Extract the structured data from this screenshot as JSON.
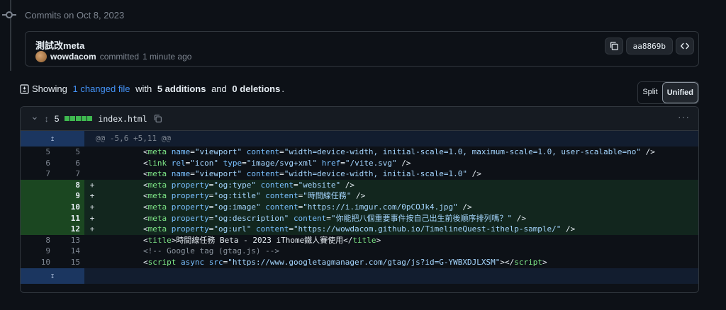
{
  "timeline": {
    "heading": "Commits on Oct 8, 2023"
  },
  "commit": {
    "title": "測試改meta",
    "author": "wowdacom",
    "action": "committed",
    "time": "1 minute ago",
    "sha": "aa8869b"
  },
  "summary": {
    "prefix": "Showing",
    "changed": "1 changed file",
    "with": "with",
    "additions": "5 additions",
    "and": "and",
    "deletions": "0 deletions",
    "end": "."
  },
  "view_toggle": {
    "split": "Split",
    "unified": "Unified"
  },
  "file": {
    "changes": "5",
    "name": "index.html",
    "hunk": "@@ -5,6 +5,11 @@",
    "lines": [
      {
        "type": "ctx",
        "old": "5",
        "new": "5",
        "parts": [
          [
            "t",
            "        <"
          ],
          [
            "tag",
            "meta"
          ],
          [
            "t",
            " "
          ],
          [
            "attr",
            "name"
          ],
          [
            "t",
            "="
          ],
          [
            "str",
            "\"viewport\""
          ],
          [
            "t",
            " "
          ],
          [
            "attr",
            "content"
          ],
          [
            "t",
            "="
          ],
          [
            "str",
            "\"width=device-width, initial-scale=1.0, maximum-scale=1.0, user-scalable=no\""
          ],
          [
            "t",
            " />"
          ]
        ]
      },
      {
        "type": "ctx",
        "old": "6",
        "new": "6",
        "parts": [
          [
            "t",
            "        <"
          ],
          [
            "tag",
            "link"
          ],
          [
            "t",
            " "
          ],
          [
            "attr",
            "rel"
          ],
          [
            "t",
            "="
          ],
          [
            "str",
            "\"icon\""
          ],
          [
            "t",
            " "
          ],
          [
            "attr",
            "type"
          ],
          [
            "t",
            "="
          ],
          [
            "str",
            "\"image/svg+xml\""
          ],
          [
            "t",
            " "
          ],
          [
            "attr",
            "href"
          ],
          [
            "t",
            "="
          ],
          [
            "str",
            "\"/vite.svg\""
          ],
          [
            "t",
            " />"
          ]
        ]
      },
      {
        "type": "ctx",
        "old": "7",
        "new": "7",
        "parts": [
          [
            "t",
            "        <"
          ],
          [
            "tag",
            "meta"
          ],
          [
            "t",
            " "
          ],
          [
            "attr",
            "name"
          ],
          [
            "t",
            "="
          ],
          [
            "str",
            "\"viewport\""
          ],
          [
            "t",
            " "
          ],
          [
            "attr",
            "content"
          ],
          [
            "t",
            "="
          ],
          [
            "str",
            "\"width=device-width, initial-scale=1.0\""
          ],
          [
            "t",
            " />"
          ]
        ]
      },
      {
        "type": "add",
        "old": "",
        "new": "8",
        "parts": [
          [
            "t",
            "        <"
          ],
          [
            "tag",
            "meta"
          ],
          [
            "t",
            " "
          ],
          [
            "attr",
            "property"
          ],
          [
            "t",
            "="
          ],
          [
            "str",
            "\"og:type\""
          ],
          [
            "t",
            " "
          ],
          [
            "attr",
            "content"
          ],
          [
            "t",
            "="
          ],
          [
            "str",
            "\"website\""
          ],
          [
            "t",
            " />"
          ]
        ]
      },
      {
        "type": "add",
        "old": "",
        "new": "9",
        "parts": [
          [
            "t",
            "        <"
          ],
          [
            "tag",
            "meta"
          ],
          [
            "t",
            " "
          ],
          [
            "attr",
            "property"
          ],
          [
            "t",
            "="
          ],
          [
            "str",
            "\"og:title\""
          ],
          [
            "t",
            " "
          ],
          [
            "attr",
            "content"
          ],
          [
            "t",
            "="
          ],
          [
            "str",
            "\"時間線任務\""
          ],
          [
            "t",
            " />"
          ]
        ]
      },
      {
        "type": "add",
        "old": "",
        "new": "10",
        "parts": [
          [
            "t",
            "        <"
          ],
          [
            "tag",
            "meta"
          ],
          [
            "t",
            " "
          ],
          [
            "attr",
            "property"
          ],
          [
            "t",
            "="
          ],
          [
            "str",
            "\"og:image\""
          ],
          [
            "t",
            " "
          ],
          [
            "attr",
            "content"
          ],
          [
            "t",
            "="
          ],
          [
            "str",
            "\"https://i.imgur.com/0pCOJk4.jpg\""
          ],
          [
            "t",
            " />"
          ]
        ]
      },
      {
        "type": "add",
        "old": "",
        "new": "11",
        "parts": [
          [
            "t",
            "        <"
          ],
          [
            "tag",
            "meta"
          ],
          [
            "t",
            " "
          ],
          [
            "attr",
            "property"
          ],
          [
            "t",
            "="
          ],
          [
            "str",
            "\"og:description\""
          ],
          [
            "t",
            " "
          ],
          [
            "attr",
            "content"
          ],
          [
            "t",
            "="
          ],
          [
            "str",
            "\"你能把八個重要事件按自己出生前後順序排列嗎？\""
          ],
          [
            "t",
            " />"
          ]
        ]
      },
      {
        "type": "add",
        "old": "",
        "new": "12",
        "parts": [
          [
            "t",
            "        <"
          ],
          [
            "tag",
            "meta"
          ],
          [
            "t",
            " "
          ],
          [
            "attr",
            "property"
          ],
          [
            "t",
            "="
          ],
          [
            "str",
            "\"og:url\""
          ],
          [
            "t",
            " "
          ],
          [
            "attr",
            "content"
          ],
          [
            "t",
            "="
          ],
          [
            "str",
            "\"https://wowdacom.github.io/TimelineQuest-ithelp-sample/\""
          ],
          [
            "t",
            " />"
          ]
        ]
      },
      {
        "type": "ctx",
        "old": "8",
        "new": "13",
        "parts": [
          [
            "t",
            "        <"
          ],
          [
            "tag",
            "title"
          ],
          [
            "t",
            ">時間線任務 Beta - 2023 iThome鐵人賽使用</"
          ],
          [
            "tag",
            "title"
          ],
          [
            "t",
            ">"
          ]
        ]
      },
      {
        "type": "ctx",
        "old": "9",
        "new": "14",
        "parts": [
          [
            "cmt",
            "        <!-- Google tag (gtag.js) -->"
          ]
        ]
      },
      {
        "type": "ctx",
        "old": "10",
        "new": "15",
        "parts": [
          [
            "t",
            "        <"
          ],
          [
            "tag",
            "script"
          ],
          [
            "t",
            " "
          ],
          [
            "attr",
            "async"
          ],
          [
            "t",
            " "
          ],
          [
            "attr",
            "src"
          ],
          [
            "t",
            "="
          ],
          [
            "str",
            "\"https://www.googletagmanager.com/gtag/js?id=G-YWBXDJLXSM\""
          ],
          [
            "t",
            "></"
          ],
          [
            "tag",
            "script"
          ],
          [
            "t",
            ">"
          ]
        ]
      }
    ]
  },
  "icons": {
    "copy": "copy-icon",
    "code": "code-icon",
    "expand_up": "↥",
    "expand_down": "↧",
    "chevron": "⌄",
    "kebab": "···"
  },
  "colors": {
    "background": "#0d1117",
    "addition_bg": "#12261e",
    "addition_num_bg": "#1b4721",
    "hunk_bg": "#121d2f",
    "accent_link": "#4493f8",
    "tag": "#7ee787",
    "attr": "#79c0ff",
    "string": "#a5d6ff"
  }
}
